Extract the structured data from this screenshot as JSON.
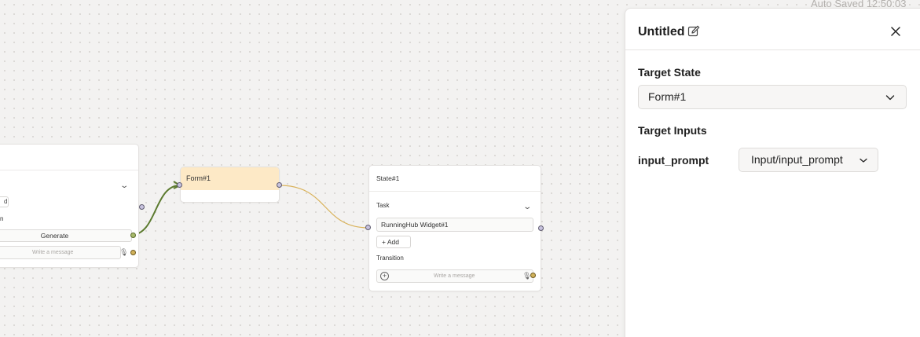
{
  "autosave": "Auto Saved 12:50:03",
  "nodes": {
    "left": {
      "tag_text": "d",
      "fragment": "n",
      "generate_label": "Generate",
      "message_placeholder": "Write a message"
    },
    "form": {
      "title": "Form#1"
    },
    "state": {
      "title": "State#1",
      "task_label": "Task",
      "widget_label": "RunningHub Widget#1",
      "add_label": "Add",
      "transition_label": "Transition",
      "message_placeholder": "Write a message"
    }
  },
  "panel": {
    "title": "Untitled",
    "target_state_label": "Target State",
    "target_state_value": "Form#1",
    "target_inputs_label": "Target Inputs",
    "input_name": "input_prompt",
    "input_value": "Input/input_prompt"
  },
  "colors": {
    "edge_green": "#5b7a2e",
    "edge_amber": "#d9b25a",
    "form_header": "#fde9c6"
  }
}
